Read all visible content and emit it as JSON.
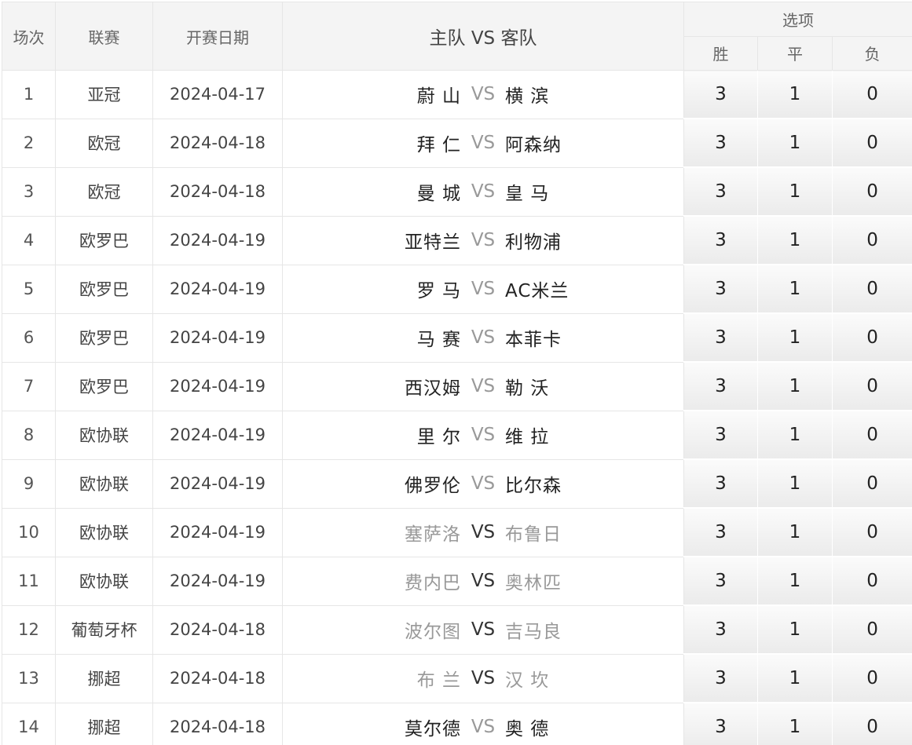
{
  "header": {
    "round": "场次",
    "league": "联赛",
    "date": "开赛日期",
    "match": "主队 VS 客队",
    "options": "选项",
    "win": "胜",
    "draw": "平",
    "loss": "负"
  },
  "rows": [
    {
      "no": "1",
      "league": "亚冠",
      "date": "2024-04-17",
      "home": "蔚 山",
      "vs": "VS",
      "away": "横 滨",
      "win": "3",
      "draw": "1",
      "loss": "0",
      "style": "normal"
    },
    {
      "no": "2",
      "league": "欧冠",
      "date": "2024-04-18",
      "home": "拜 仁",
      "vs": "VS",
      "away": "阿森纳",
      "win": "3",
      "draw": "1",
      "loss": "0",
      "style": "normal"
    },
    {
      "no": "3",
      "league": "欧冠",
      "date": "2024-04-18",
      "home": "曼 城",
      "vs": "VS",
      "away": "皇 马",
      "win": "3",
      "draw": "1",
      "loss": "0",
      "style": "normal"
    },
    {
      "no": "4",
      "league": "欧罗巴",
      "date": "2024-04-19",
      "home": "亚特兰",
      "vs": "VS",
      "away": "利物浦",
      "win": "3",
      "draw": "1",
      "loss": "0",
      "style": "normal"
    },
    {
      "no": "5",
      "league": "欧罗巴",
      "date": "2024-04-19",
      "home": "罗 马",
      "vs": "VS",
      "away": "AC米兰",
      "win": "3",
      "draw": "1",
      "loss": "0",
      "style": "normal"
    },
    {
      "no": "6",
      "league": "欧罗巴",
      "date": "2024-04-19",
      "home": "马 赛",
      "vs": "VS",
      "away": "本菲卡",
      "win": "3",
      "draw": "1",
      "loss": "0",
      "style": "normal"
    },
    {
      "no": "7",
      "league": "欧罗巴",
      "date": "2024-04-19",
      "home": "西汉姆",
      "vs": "VS",
      "away": "勒 沃",
      "win": "3",
      "draw": "1",
      "loss": "0",
      "style": "normal"
    },
    {
      "no": "8",
      "league": "欧协联",
      "date": "2024-04-19",
      "home": "里 尔",
      "vs": "VS",
      "away": "维 拉",
      "win": "3",
      "draw": "1",
      "loss": "0",
      "style": "normal"
    },
    {
      "no": "9",
      "league": "欧协联",
      "date": "2024-04-19",
      "home": "佛罗伦",
      "vs": "VS",
      "away": "比尔森",
      "win": "3",
      "draw": "1",
      "loss": "0",
      "style": "normal"
    },
    {
      "no": "10",
      "league": "欧协联",
      "date": "2024-04-19",
      "home": "塞萨洛",
      "vs": "VS",
      "away": "布鲁日",
      "win": "3",
      "draw": "1",
      "loss": "0",
      "style": "dim"
    },
    {
      "no": "11",
      "league": "欧协联",
      "date": "2024-04-19",
      "home": "费内巴",
      "vs": "VS",
      "away": "奥林匹",
      "win": "3",
      "draw": "1",
      "loss": "0",
      "style": "dim"
    },
    {
      "no": "12",
      "league": "葡萄牙杯",
      "date": "2024-04-18",
      "home": "波尔图",
      "vs": "VS",
      "away": "吉马良",
      "win": "3",
      "draw": "1",
      "loss": "0",
      "style": "dim"
    },
    {
      "no": "13",
      "league": "挪超",
      "date": "2024-04-18",
      "home": "布 兰",
      "vs": "VS",
      "away": "汉 坎",
      "win": "3",
      "draw": "1",
      "loss": "0",
      "style": "dim"
    },
    {
      "no": "14",
      "league": "挪超",
      "date": "2024-04-18",
      "home": "莫尔德",
      "vs": "VS",
      "away": "奥 德",
      "win": "3",
      "draw": "1",
      "loss": "0",
      "style": "normal"
    }
  ],
  "colors": {
    "dim_text": "#999999",
    "header_bg": "#f4f4f4",
    "border": "#e6e6e6"
  }
}
